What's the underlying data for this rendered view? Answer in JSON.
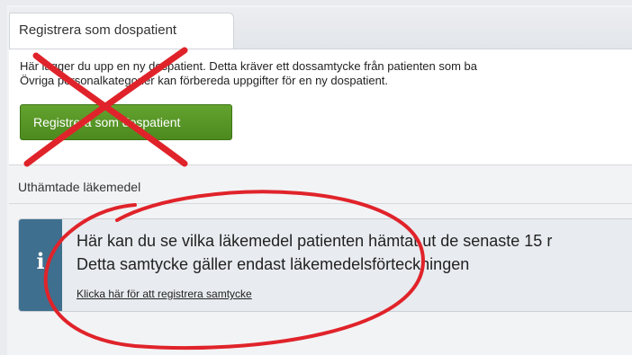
{
  "register_panel": {
    "tab_label": "Registrera som dospatient",
    "description_line1": "Här lägger du upp en ny dospatient. Detta kräver ett dossamtycke från patienten som ba",
    "description_line2": "Övriga personalkategorier kan förbereda uppgifter för en ny dospatient.",
    "button_label": "Registrera som dospatient"
  },
  "dispensed_section": {
    "title": "Uthämtade läkemedel"
  },
  "info_box": {
    "icon": "info-icon",
    "line1": "Här kan du se vilka läkemedel patienten hämtat ut de senaste 15 r",
    "line2": "Detta samtycke gäller endast läkemedelsförteckningen",
    "link_label": "Klicka här för att registrera samtycke"
  },
  "annotations": {
    "cross_color": "#e0232a",
    "ellipse_color": "#e0232a"
  }
}
